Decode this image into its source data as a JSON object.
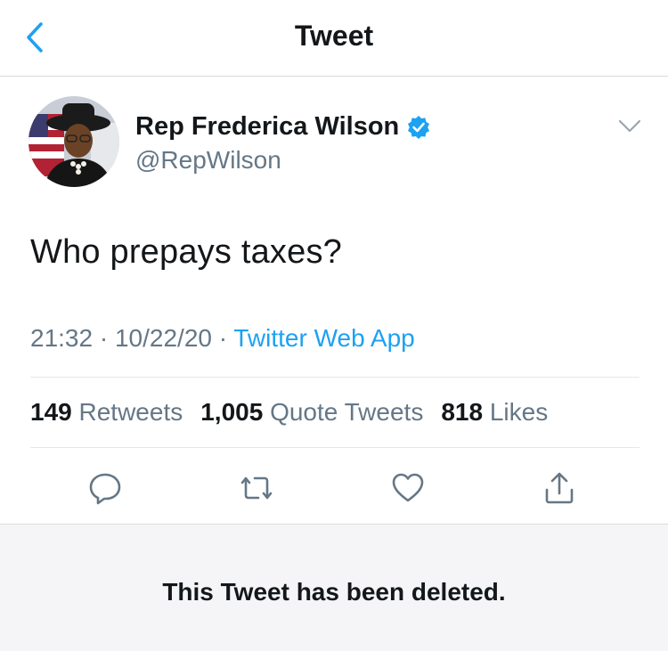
{
  "nav": {
    "title": "Tweet",
    "back_icon": "chevron-left-icon"
  },
  "author": {
    "name": "Rep Frederica Wilson",
    "handle": "@RepWilson",
    "verified_icon": "verified-badge-icon"
  },
  "tweet": {
    "text": "Who prepays taxes?"
  },
  "meta": {
    "time": "21:32",
    "separator1": "·",
    "date": "10/22/20",
    "separator2": "·",
    "source": "Twitter Web App"
  },
  "stats": {
    "retweets_count": "149",
    "retweets_label": "Retweets",
    "quotes_count": "1,005",
    "quotes_label": "Quote Tweets",
    "likes_count": "818",
    "likes_label": "Likes"
  },
  "actions": {
    "reply_icon": "reply-icon",
    "retweet_icon": "retweet-icon",
    "like_icon": "heart-icon",
    "share_icon": "share-icon"
  },
  "notice": {
    "deleted_text": "This Tweet has been deleted."
  },
  "colors": {
    "accent": "#1da1f2",
    "secondary_text": "#657786",
    "primary_text": "#14171a",
    "icon_gray": "#657786",
    "deleted_bg": "#f5f5f7"
  }
}
